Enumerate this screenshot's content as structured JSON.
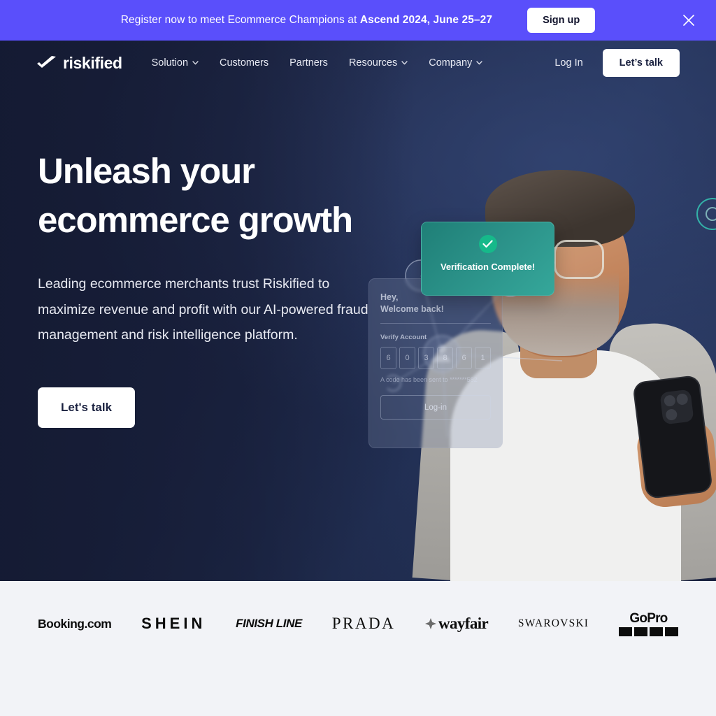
{
  "announcement": {
    "text_lead": "Register now to meet Ecommerce Champions at ",
    "text_strong": "Ascend 2024, June 25–27",
    "signup_label": "Sign up",
    "close_icon": "close-icon",
    "background_color": "#5A4FFB"
  },
  "nav": {
    "logo_text": "riskified",
    "logo_icon": "checkmark-icon",
    "links": [
      {
        "label": "Solution",
        "has_dropdown": true
      },
      {
        "label": "Customers",
        "has_dropdown": false
      },
      {
        "label": "Partners",
        "has_dropdown": false
      },
      {
        "label": "Resources",
        "has_dropdown": true
      },
      {
        "label": "Company",
        "has_dropdown": true
      }
    ],
    "login_label": "Log In",
    "cta_label": "Let’s talk"
  },
  "hero": {
    "heading_line1": "Unleash your",
    "heading_line2": "ecommerce growth",
    "subheading": "Leading ecommerce merchants trust Riskified to maximize revenue and profit with our AI-powered fraud management and risk intelligence platform.",
    "cta_label": "Let's talk",
    "background_color": "#1C2442"
  },
  "mockup": {
    "login_card": {
      "greeting_line1": "Hey,",
      "greeting_line2": "Welcome back!",
      "verify_label": "Verify Account",
      "otp_digits": [
        "6",
        "0",
        "3",
        "8",
        "6",
        "1"
      ],
      "code_note": "A code has been sent to *******582",
      "submit_label": "Log-in"
    },
    "verification_toast": {
      "icon": "check-circle-icon",
      "text": "Verification Complete!",
      "accent_color": "#16B98A"
    },
    "network_graph": {
      "nodes": [
        "person-node",
        "email-node",
        "user-node",
        "dot-node"
      ]
    }
  },
  "logo_strip": {
    "background_color": "#F2F3F7",
    "brands": [
      {
        "name": "Booking.com"
      },
      {
        "name": "SHEIN"
      },
      {
        "name": "FINISH LINE"
      },
      {
        "name": "PRADA"
      },
      {
        "name": "wayfair"
      },
      {
        "name": "SWAROVSKI"
      },
      {
        "name": "GoPro"
      }
    ]
  }
}
